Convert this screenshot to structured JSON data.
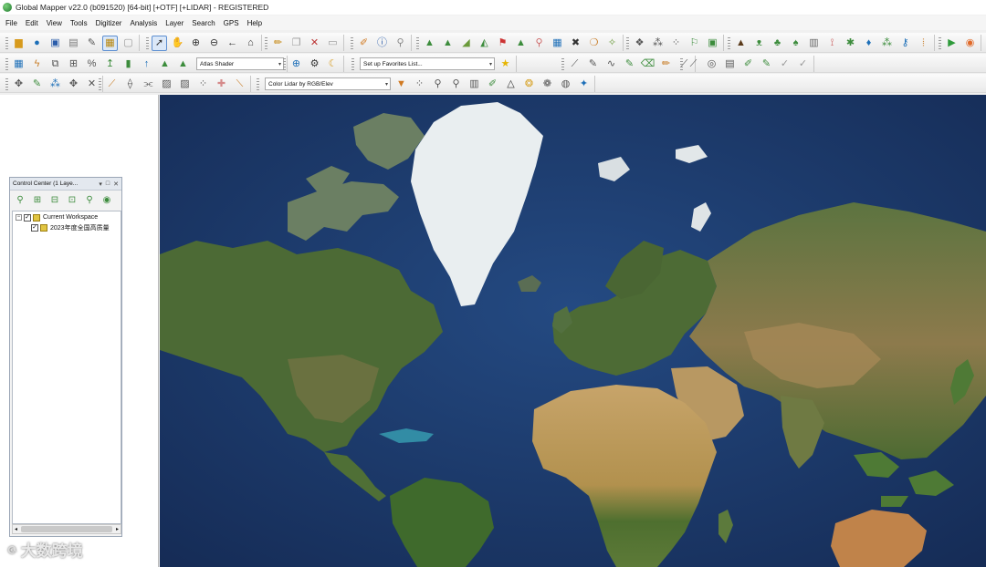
{
  "window": {
    "title": "Global Mapper v22.0 (b091520) [64-bit] [+OTF] [+LIDAR] - REGISTERED"
  },
  "menu": [
    "File",
    "Edit",
    "View",
    "Tools",
    "Digitizer",
    "Analysis",
    "Layer",
    "Search",
    "GPS",
    "Help"
  ],
  "toolbars": {
    "shader_select": "Atlas Shader",
    "favorites_select": "Set up Favorites List...",
    "lidar_color_select": "Color Lidar by RGB/Elev"
  },
  "control_center": {
    "title": "Control Center (1 Laye...",
    "workspace_label": "Current Workspace",
    "layer_label": "2023年度全国高质量"
  },
  "watermark": {
    "text": "大数跨境",
    "icon": "chat-bubble-icon"
  },
  "colors": {
    "ocean": "#1b3667",
    "land": "#4a6a34",
    "ice": "#e9eef0",
    "desert": "#b99a62"
  }
}
